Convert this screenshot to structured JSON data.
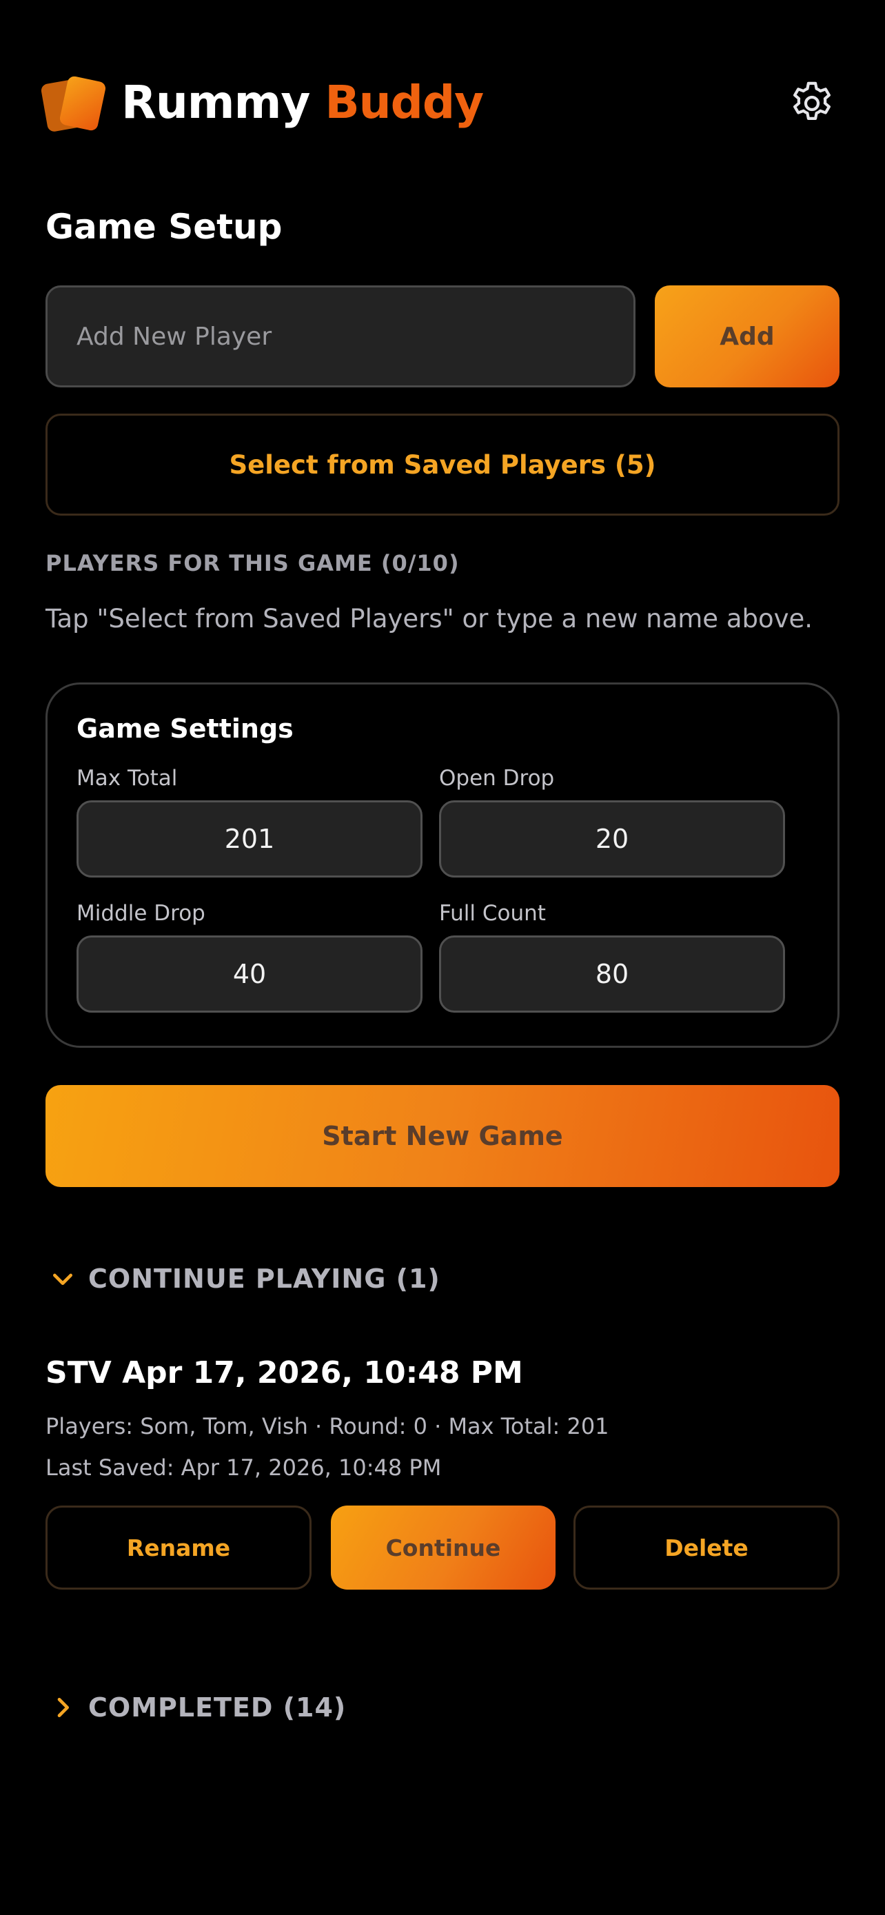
{
  "header": {
    "brand_part1": "Rummy",
    "brand_part2": "Buddy",
    "settings_icon": "gear-icon",
    "logo_icon": "cards-logo-icon"
  },
  "setup": {
    "title": "Game Setup",
    "player_input_placeholder": "Add New Player",
    "player_input_value": "",
    "add_label": "Add",
    "saved_players_label": "Select from Saved Players (5)",
    "players_heading": "PLAYERS FOR THIS GAME (0/10)",
    "hint": "Tap \"Select from Saved Players\" or type a new name above."
  },
  "game_settings": {
    "title": "Game Settings",
    "fields": [
      {
        "label": "Max Total",
        "value": "201"
      },
      {
        "label": "Open Drop",
        "value": "20"
      },
      {
        "label": "Middle Drop",
        "value": "40"
      },
      {
        "label": "Full Count",
        "value": "80"
      }
    ]
  },
  "start_label": "Start New Game",
  "continue_section": {
    "heading": "CONTINUE PLAYING (1)",
    "expanded": true,
    "game": {
      "title": "STV Apr 17, 2026, 10:48 PM",
      "players_line": "Players: Som, Tom, Vish · Round: 0 · Max Total: 201",
      "saved_line": "Last Saved: Apr 17, 2026, 10:48 PM",
      "rename_label": "Rename",
      "continue_label": "Continue",
      "delete_label": "Delete"
    }
  },
  "completed_section": {
    "heading": "COMPLETED (14)",
    "expanded": false
  },
  "colors": {
    "accent_orange": "#f5a524",
    "brand_orange": "#f0620f",
    "gradient_start": "#f7a219",
    "gradient_end": "#e8540d",
    "background": "#000000"
  }
}
